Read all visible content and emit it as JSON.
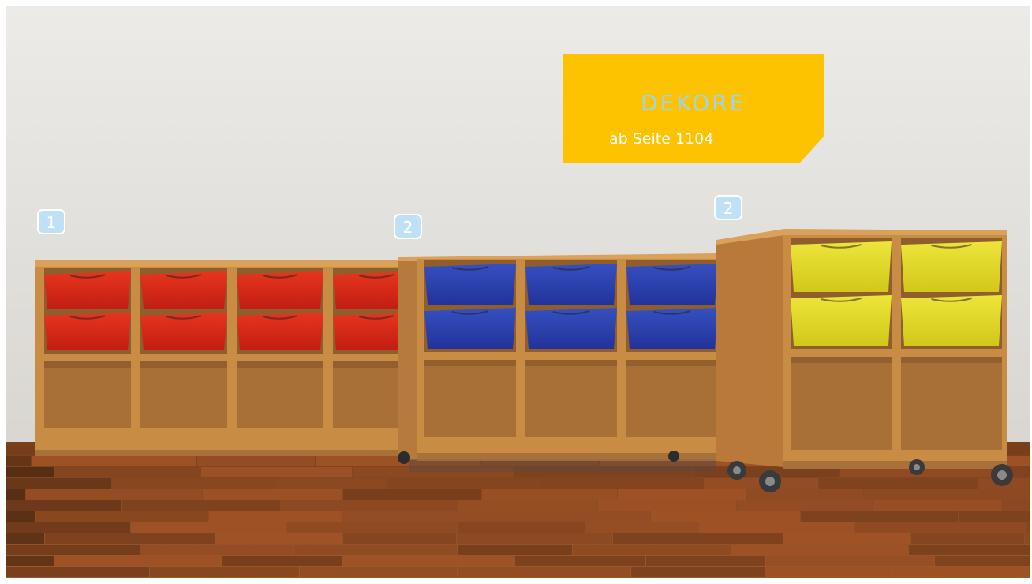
{
  "badges": [
    {
      "label": "1"
    },
    {
      "label": "2"
    },
    {
      "label": "2"
    }
  ],
  "promo": {
    "title": "DEKORE",
    "subtitle": "ab Seite 1104",
    "tile_color": "#fdc200",
    "title_color": "#9ed3f2"
  },
  "colors": {
    "wall": "#ecebe8",
    "floor": "#8a4a22",
    "wood": "#c98c45",
    "bins_left": "#d9291b",
    "bins_middle": "#2a3fa8",
    "bins_right": "#e6df2a",
    "badge_fill": "#bfe1f6"
  }
}
